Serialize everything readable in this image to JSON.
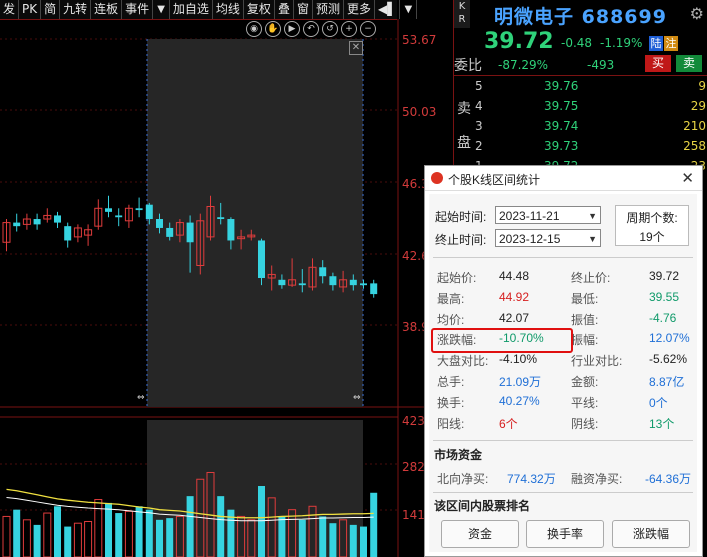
{
  "toolbar": {
    "items": [
      "发",
      "PK",
      "简",
      "九转",
      "连板",
      "事件",
      "▼",
      "加自选",
      "均线",
      "复权",
      "叠",
      "窗",
      "预测",
      "更多",
      "◀▌",
      "▼"
    ]
  },
  "chart": {
    "price_axis": [
      "53.67",
      "50.03",
      "46.3",
      "42.6",
      "38.9"
    ],
    "volume_axis": [
      "423",
      "282",
      "141"
    ],
    "icons": [
      "eye-icon",
      "hand-icon",
      "play-icon",
      "undo-icon",
      "reset-icon",
      "zoom-in-icon",
      "zoom-out-icon"
    ]
  },
  "chart_data": {
    "type": "candlestick",
    "ylim": [
      37.0,
      53.67
    ],
    "candles": [
      {
        "o": 42.3,
        "c": 43.4,
        "h": 43.6,
        "l": 41.8
      },
      {
        "o": 43.4,
        "c": 43.2,
        "h": 43.9,
        "l": 42.9
      },
      {
        "o": 43.3,
        "c": 43.6,
        "h": 43.9,
        "l": 43.0
      },
      {
        "o": 43.6,
        "c": 43.3,
        "h": 43.9,
        "l": 43.0
      },
      {
        "o": 43.6,
        "c": 43.8,
        "h": 44.2,
        "l": 43.4
      },
      {
        "o": 43.8,
        "c": 43.4,
        "h": 44.0,
        "l": 43.1
      },
      {
        "o": 43.2,
        "c": 42.4,
        "h": 43.4,
        "l": 42.0
      },
      {
        "o": 42.6,
        "c": 43.1,
        "h": 43.3,
        "l": 42.3
      },
      {
        "o": 42.7,
        "c": 43.0,
        "h": 43.3,
        "l": 42.1
      },
      {
        "o": 43.2,
        "c": 44.2,
        "h": 44.7,
        "l": 43.0
      },
      {
        "o": 44.2,
        "c": 44.0,
        "h": 44.9,
        "l": 43.7
      },
      {
        "o": 43.8,
        "c": 43.7,
        "h": 44.2,
        "l": 43.2
      },
      {
        "o": 43.5,
        "c": 44.2,
        "h": 44.4,
        "l": 43.1
      },
      {
        "o": 44.2,
        "c": 44.1,
        "h": 44.8,
        "l": 43.7
      },
      {
        "o": 44.4,
        "c": 43.6,
        "h": 44.5,
        "l": 43.3
      },
      {
        "o": 43.6,
        "c": 43.1,
        "h": 43.9,
        "l": 42.8
      },
      {
        "o": 43.1,
        "c": 42.6,
        "h": 43.4,
        "l": 42.4
      },
      {
        "o": 42.7,
        "c": 43.4,
        "h": 43.6,
        "l": 42.3
      },
      {
        "o": 43.4,
        "c": 42.3,
        "h": 43.8,
        "l": 40.6
      },
      {
        "o": 41.0,
        "c": 43.5,
        "h": 43.9,
        "l": 40.5
      },
      {
        "o": 42.6,
        "c": 44.3,
        "h": 44.9,
        "l": 42.4
      },
      {
        "o": 43.7,
        "c": 43.6,
        "h": 44.5,
        "l": 43.3
      },
      {
        "o": 43.6,
        "c": 42.4,
        "h": 43.7,
        "l": 41.9
      },
      {
        "o": 42.5,
        "c": 42.6,
        "h": 43.0,
        "l": 41.9
      },
      {
        "o": 42.6,
        "c": 42.7,
        "h": 43.0,
        "l": 42.4
      },
      {
        "o": 42.4,
        "c": 40.3,
        "h": 42.5,
        "l": 39.9
      },
      {
        "o": 40.3,
        "c": 40.5,
        "h": 41.0,
        "l": 39.6
      },
      {
        "o": 40.2,
        "c": 39.9,
        "h": 40.5,
        "l": 39.7
      },
      {
        "o": 39.9,
        "c": 40.2,
        "h": 41.4,
        "l": 39.8
      },
      {
        "o": 40.0,
        "c": 39.9,
        "h": 40.8,
        "l": 39.5
      },
      {
        "o": 39.8,
        "c": 40.9,
        "h": 41.4,
        "l": 39.6
      },
      {
        "o": 40.9,
        "c": 40.4,
        "h": 41.3,
        "l": 40.0
      },
      {
        "o": 40.4,
        "c": 39.9,
        "h": 40.6,
        "l": 39.6
      },
      {
        "o": 39.8,
        "c": 40.2,
        "h": 40.7,
        "l": 39.5
      },
      {
        "o": 40.2,
        "c": 39.9,
        "h": 40.5,
        "l": 39.6
      },
      {
        "o": 40.0,
        "c": 39.9,
        "h": 40.2,
        "l": 39.7
      },
      {
        "o": 40.0,
        "c": 39.4,
        "h": 40.2,
        "l": 39.2
      }
    ],
    "volume_max": 423,
    "volumes": [
      120,
      140,
      110,
      95,
      130,
      150,
      90,
      100,
      105,
      170,
      160,
      130,
      135,
      150,
      140,
      110,
      115,
      120,
      180,
      230,
      250,
      180,
      140,
      120,
      110,
      210,
      175,
      120,
      140,
      110,
      150,
      120,
      100,
      110,
      95,
      90,
      190
    ],
    "volume_up": [
      true,
      false,
      true,
      false,
      true,
      false,
      false,
      true,
      true,
      true,
      false,
      false,
      true,
      false,
      false,
      false,
      false,
      true,
      false,
      true,
      true,
      false,
      false,
      true,
      true,
      false,
      true,
      false,
      true,
      false,
      true,
      false,
      false,
      true,
      false,
      false,
      false
    ],
    "ma_line": [
      200,
      196,
      190,
      184,
      178,
      172,
      168,
      165,
      162,
      160,
      158,
      156,
      152,
      148,
      145,
      140,
      138,
      136,
      132,
      128,
      124,
      120,
      118,
      116,
      116,
      116,
      118,
      120,
      121,
      122,
      124,
      126,
      126,
      127,
      128,
      128,
      129
    ]
  },
  "quote": {
    "side_label": [
      "K",
      "R"
    ],
    "name": "明微电子",
    "code": "688699",
    "price": "39.72",
    "change": "-0.48",
    "change_pct": "-1.19%",
    "badge_lu": "陆",
    "badge_zhu": "注",
    "weibi_label": "委比",
    "weibi_pct": "-87.29%",
    "weibi_diff": "-493",
    "buy_btn": "买",
    "sell_btn": "卖",
    "sell_side_label": [
      "卖",
      "盘"
    ],
    "orders": [
      {
        "lvl": "5",
        "px": "39.76",
        "qty": "9"
      },
      {
        "lvl": "4",
        "px": "39.75",
        "qty": "29"
      },
      {
        "lvl": "3",
        "px": "39.74",
        "qty": "210"
      },
      {
        "lvl": "2",
        "px": "39.73",
        "qty": "258"
      },
      {
        "lvl": "1",
        "px": "39.72",
        "qty": "23"
      }
    ]
  },
  "dialog": {
    "title": "个股K线区间统计",
    "start_label": "起始时间:",
    "start_value": "2023-11-21",
    "end_label": "终止时间:",
    "end_value": "2023-12-15",
    "period_label": "周期个数:",
    "period_value": "19个",
    "stats_left": [
      {
        "label": "起始价:",
        "value": "44.48",
        "color": "neutral"
      },
      {
        "label": "最高:",
        "value": "44.92",
        "color": "red"
      },
      {
        "label": "均价:",
        "value": "42.07",
        "color": "neutral"
      },
      {
        "label": "涨跌幅:",
        "value": "-10.70%",
        "color": "green"
      },
      {
        "label": "大盘对比:",
        "value": "-4.10%",
        "color": "neutral"
      },
      {
        "label": "总手:",
        "value": "21.09万",
        "color": "blue"
      },
      {
        "label": "换手:",
        "value": "40.27%",
        "color": "blue"
      },
      {
        "label": "阳线:",
        "value": "6个",
        "color": "red"
      }
    ],
    "stats_right": [
      {
        "label": "终止价:",
        "value": "39.72",
        "color": "neutral"
      },
      {
        "label": "最低:",
        "value": "39.55",
        "color": "green"
      },
      {
        "label": "振值:",
        "value": "-4.76",
        "color": "green"
      },
      {
        "label": "振幅:",
        "value": "12.07%",
        "color": "blue"
      },
      {
        "label": "行业对比:",
        "value": "-5.62%",
        "color": "neutral"
      },
      {
        "label": "金额:",
        "value": "8.87亿",
        "color": "blue"
      },
      {
        "label": "平线:",
        "value": "0个",
        "color": "blue"
      },
      {
        "label": "阴线:",
        "value": "13个",
        "color": "green"
      }
    ],
    "fund_title": "市场资金",
    "north_label": "北向净买:",
    "north_value": "774.32万",
    "margin_label": "融资净买:",
    "margin_value": "-64.36万",
    "rank_title": "该区间内股票排名",
    "rank_buttons": [
      "资金",
      "换手率",
      "涨跌幅"
    ]
  }
}
